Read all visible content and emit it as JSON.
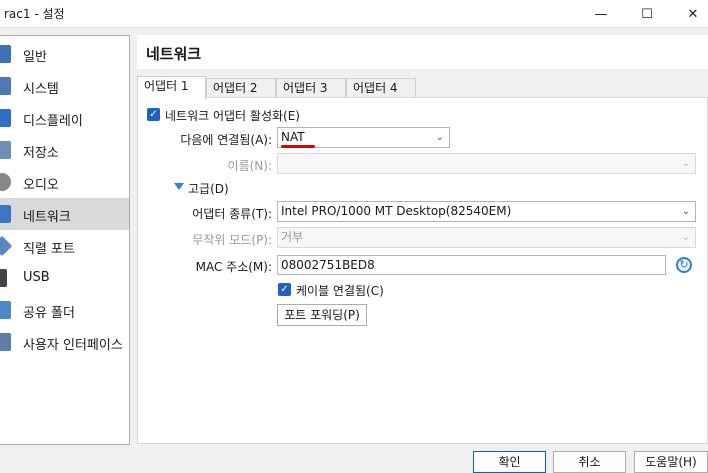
{
  "window": {
    "title": "rac1 - 설정",
    "min_icon": "minimize-icon",
    "max_icon": "maximize-icon",
    "close_icon": "close-icon"
  },
  "sidebar": {
    "items": [
      {
        "label": "일반",
        "icon": "general-icon",
        "color": "#3f6fb5"
      },
      {
        "label": "시스템",
        "icon": "system-icon",
        "color": "#4a7bb8"
      },
      {
        "label": "디스플레이",
        "icon": "display-icon",
        "color": "#2c6fc4"
      },
      {
        "label": "저장소",
        "icon": "storage-icon",
        "color": "#6b8fb8"
      },
      {
        "label": "오디오",
        "icon": "audio-icon",
        "color": "#888888"
      },
      {
        "label": "네트워크",
        "icon": "network-icon",
        "color": "#3b78c4"
      },
      {
        "label": "직렬 포트",
        "icon": "serial-port-icon",
        "color": "#5a86c2"
      },
      {
        "label": "USB",
        "icon": "usb-icon",
        "color": "#444444"
      },
      {
        "label": "공유 폴더",
        "icon": "shared-folder-icon",
        "color": "#4d87c7"
      },
      {
        "label": "사용자 인터페이스",
        "icon": "user-interface-icon",
        "color": "#5b7fa8"
      }
    ],
    "selected_index": 5
  },
  "header": {
    "title": "네트워크"
  },
  "tabs": [
    "어댑터 1",
    "어댑터 2",
    "어댑터 3",
    "어댑터 4"
  ],
  "adapter": {
    "enable_label": "네트워크 어댑터 활성화(E)",
    "attached_label": "다음에 연결됨(A):",
    "attached_value": "NAT",
    "name_label": "이름(N):",
    "name_value": "",
    "advanced_label": "고급(D)",
    "type_label": "어댑터 종류(T):",
    "type_value": "Intel PRO/1000 MT Desktop(82540EM)",
    "promisc_label": "무작위 모드(P):",
    "promisc_value": "거부",
    "mac_label": "MAC 주소(M):",
    "mac_value": "08002751BED8",
    "cable_label": "케이블 연결됨(C)",
    "port_forward_label": "포트 포워딩(P)"
  },
  "footer": {
    "ok": "확인",
    "cancel": "취소",
    "help": "도움말(H)"
  },
  "colors": {
    "accent": "#1f63bf",
    "highlight_underline": "#e00000"
  }
}
